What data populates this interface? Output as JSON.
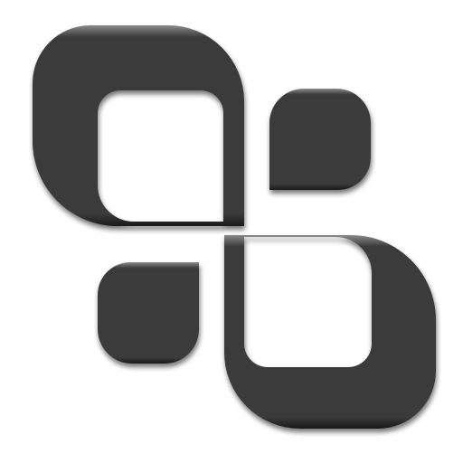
{
  "canvas": {
    "background": "#ffffff"
  },
  "logo": {
    "icon": "four-rounded-leaf-knot-icon",
    "fill_color": "#3a3a3a",
    "highlight_color": "#8a8a8a",
    "shadow_color": "#1a1a1a"
  }
}
